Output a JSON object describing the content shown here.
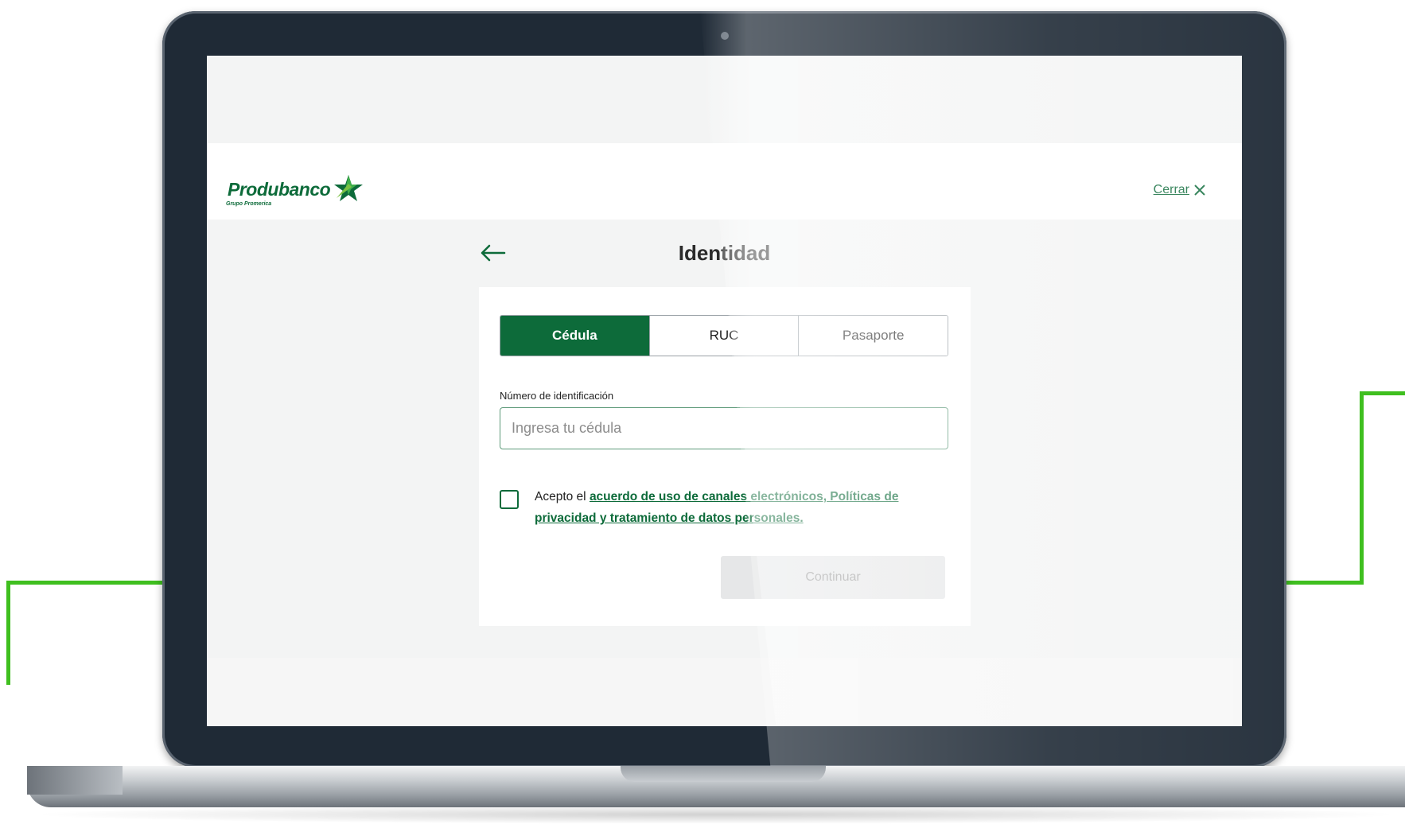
{
  "brand": {
    "name": "Produbanco",
    "tagline": "Grupo Promerica",
    "primary_color": "#0d6b3a",
    "accent_line_color": "#3fbf1f"
  },
  "header": {
    "close_label": "Cerrar",
    "close_icon": "close-icon"
  },
  "page": {
    "title": "Identidad",
    "back_icon": "arrow-left-icon"
  },
  "tabs": [
    {
      "label": "Cédula",
      "active": true
    },
    {
      "label": "RUC",
      "active": false
    },
    {
      "label": "Pasaporte",
      "active": false
    }
  ],
  "form": {
    "id_label": "Número de identificación",
    "id_placeholder": "Ingresa tu cédula",
    "consent_prefix": "Acepto el ",
    "consent_link": "acuerdo de uso de canales electrónicos, Políticas de privacidad y tratamiento de datos personales.",
    "consent_checked": false,
    "continue_label": "Continuar",
    "continue_enabled": false
  }
}
